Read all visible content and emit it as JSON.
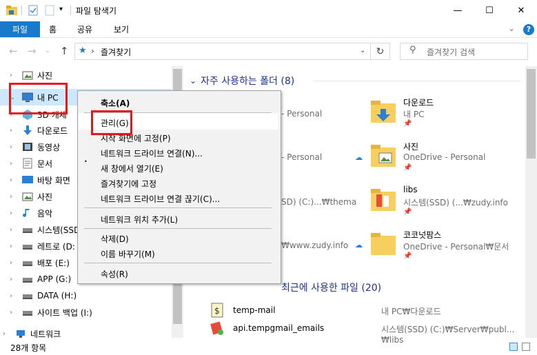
{
  "window": {
    "title": "파일 탐색기",
    "min": "—",
    "max": "☐",
    "close": "✕"
  },
  "ribbon": {
    "tabs": [
      "파일",
      "홈",
      "공유",
      "보기"
    ],
    "help": "?"
  },
  "address": {
    "path": "즐겨찾기",
    "search_placeholder": "즐겨찾기 검색"
  },
  "nav_tree": [
    {
      "label": "사진",
      "icon": "pictures-icon"
    },
    {
      "label": "내 PC",
      "icon": "computer-icon",
      "selected": true
    },
    {
      "label": "3D 개체",
      "icon": "3d-objects-icon"
    },
    {
      "label": "다운로드",
      "icon": "download-icon"
    },
    {
      "label": "동영상",
      "icon": "video-icon"
    },
    {
      "label": "문서",
      "icon": "document-icon"
    },
    {
      "label": "바탕 화면",
      "icon": "desktop-icon"
    },
    {
      "label": "사진",
      "icon": "pictures-icon"
    },
    {
      "label": "음악",
      "icon": "music-icon"
    },
    {
      "label": "시스템(SSD",
      "icon": "drive-icon"
    },
    {
      "label": "레트로 (D:",
      "icon": "drive-icon"
    },
    {
      "label": "배포 (E:)",
      "icon": "drive-icon"
    },
    {
      "label": "APP (G:)",
      "icon": "drive-icon"
    },
    {
      "label": "DATA (H:)",
      "icon": "drive-icon"
    },
    {
      "label": "사이트 백업 (I:)",
      "icon": "drive-icon"
    },
    {
      "label": "네트워크",
      "icon": "network-icon"
    }
  ],
  "frequent": {
    "title": "자주 사용하는 폴더 (8)",
    "left_col": [
      {
        "sub": "- Personal"
      },
      {
        "sub": "- Personal"
      },
      {
        "sub": "SD) (C:)...₩thema"
      },
      {
        "sub": "₩www.zudy.info"
      }
    ],
    "right_col": [
      {
        "name": "다운로드",
        "sub": "내 PC",
        "pin": "📌"
      },
      {
        "name": "사진",
        "sub": "OneDrive - Personal",
        "pin": "📌"
      },
      {
        "name": "libs",
        "sub": "시스템(SSD) (...₩zudy.info",
        "pin": "📌"
      },
      {
        "name": "코코넛팜스",
        "sub": "OneDrive - Personal₩문서",
        "pin": "📌"
      }
    ]
  },
  "recent": {
    "title": "최근에 사용한 파일 (20)",
    "files": [
      {
        "name": "temp-mail",
        "path": "내 PC₩다운로드"
      },
      {
        "name": "api.tempgmail_emails",
        "path": "시스템(SSD) (C:)₩Server₩publ...₩libs"
      }
    ]
  },
  "context_menu": {
    "items": [
      "축소(A)",
      "관리(G)",
      "시작 화면에 고정(P)",
      "네트워크 드라이브 연결(N)...",
      "새 창에서 열기(E)",
      "즐겨찾기에 고정",
      "네트워크 드라이브 연결 끊기(C)...",
      "네트워크 위치 추가(L)",
      "삭제(D)",
      "이름 바꾸기(M)",
      "속성(R)"
    ]
  },
  "status": {
    "count": "28개 항목"
  },
  "colors": {
    "accent": "#1979ca",
    "highlight": "#e8151c",
    "selection": "#cce8ff",
    "group_title": "#1e3287"
  }
}
